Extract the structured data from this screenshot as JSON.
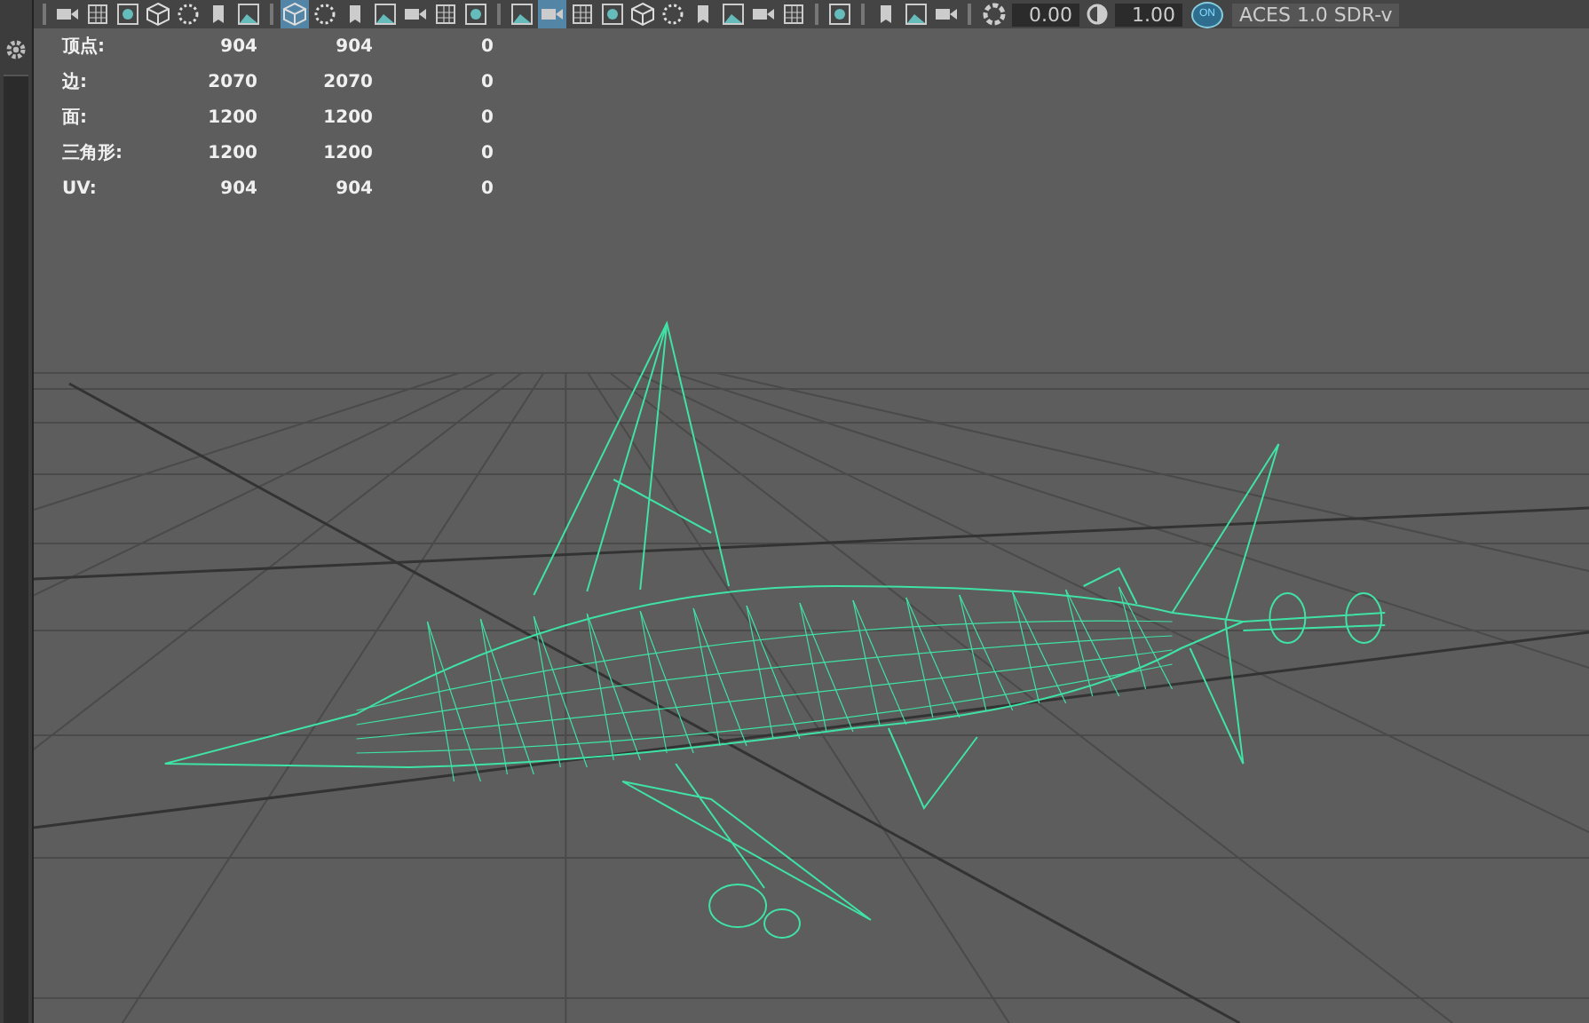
{
  "toolbar": {
    "groups": [
      {
        "buttons": [
          {
            "selected": false
          },
          {
            "selected": false
          },
          {
            "selected": false
          },
          {
            "selected": false
          },
          {
            "selected": false
          },
          {
            "selected": false
          },
          {
            "selected": false
          }
        ]
      },
      {
        "buttons": [
          {
            "selected": true
          },
          {
            "selected": false
          },
          {
            "selected": false
          },
          {
            "selected": false
          },
          {
            "selected": false
          },
          {
            "selected": false
          },
          {
            "selected": false
          }
        ]
      },
      {
        "buttons": [
          {
            "selected": false
          },
          {
            "selected": true
          },
          {
            "selected": false
          },
          {
            "selected": false
          },
          {
            "selected": false
          },
          {
            "selected": false
          },
          {
            "selected": false
          },
          {
            "selected": false
          },
          {
            "selected": false
          },
          {
            "selected": false
          }
        ]
      },
      {
        "buttons": [
          {
            "selected": false
          }
        ]
      },
      {
        "buttons": [
          {
            "selected": false
          },
          {
            "selected": false
          },
          {
            "selected": false
          }
        ]
      }
    ],
    "exposure": "0.00",
    "gamma": "1.00",
    "color_management": "ON",
    "view_transform": "ACES 1.0 SDR-v"
  },
  "stats": [
    {
      "label": "顶点:",
      "column_1": "904",
      "column_2": "904",
      "column_3": "0"
    },
    {
      "label": "边:",
      "column_1": "2070",
      "column_2": "2070",
      "column_3": "0"
    },
    {
      "label": "面:",
      "column_1": "1200",
      "column_2": "1200",
      "column_3": "0"
    },
    {
      "label": "三角形:",
      "column_1": "1200",
      "column_2": "1200",
      "column_3": "0"
    },
    {
      "label": "UV:",
      "column_1": "904",
      "column_2": "904",
      "column_3": "0"
    }
  ]
}
